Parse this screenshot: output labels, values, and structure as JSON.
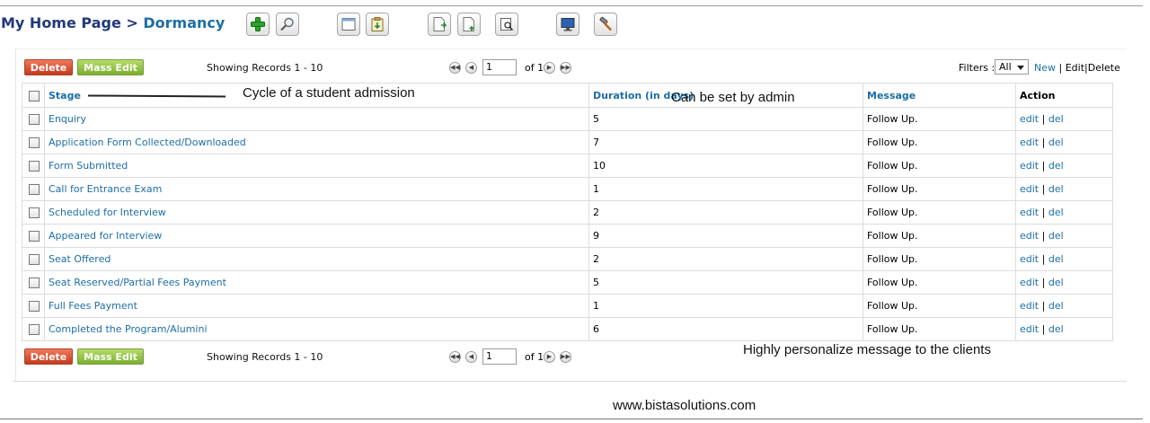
{
  "breadcrumb": {
    "home": "My Home Page",
    "separator": ">",
    "current": "Dormancy"
  },
  "toolbar": {
    "icons": [
      "add-icon",
      "search-icon",
      "window-icon",
      "import-icon",
      "export-icon",
      "export-alt-icon",
      "find-duplicates-icon",
      "monitor-icon",
      "settings-hammer-icon"
    ]
  },
  "actions": {
    "delete_label": "Delete",
    "mass_edit_label": "Mass Edit"
  },
  "pagination": {
    "showing": "Showing Records 1 - 10",
    "page_value": "1",
    "of_pages": "of 1"
  },
  "filters": {
    "label": "Filters :",
    "selected": "All",
    "new": "New",
    "sep": "|",
    "edit": "Edit",
    "delete": "Delete"
  },
  "table": {
    "headers": {
      "stage": "Stage",
      "duration": "Duration (in days)",
      "message": "Message",
      "action": "Action"
    },
    "rows": [
      {
        "stage": "Enquiry",
        "duration": "5",
        "message": "Follow Up."
      },
      {
        "stage": "Application Form Collected/Downloaded",
        "duration": "7",
        "message": "Follow Up."
      },
      {
        "stage": "Form Submitted",
        "duration": "10",
        "message": "Follow Up."
      },
      {
        "stage": "Call for Entrance Exam",
        "duration": "1",
        "message": "Follow Up."
      },
      {
        "stage": "Scheduled for Interview",
        "duration": "2",
        "message": "Follow Up."
      },
      {
        "stage": "Appeared for Interview",
        "duration": "9",
        "message": "Follow Up."
      },
      {
        "stage": "Seat Offered",
        "duration": "2",
        "message": "Follow Up."
      },
      {
        "stage": "Seat Reserved/Partial Fees Payment",
        "duration": "5",
        "message": "Follow Up."
      },
      {
        "stage": "Full Fees Payment",
        "duration": "1",
        "message": "Follow Up."
      },
      {
        "stage": "Completed the Program/Alumini",
        "duration": "6",
        "message": "Follow Up."
      }
    ],
    "edit_label": "edit",
    "del_label": "del",
    "action_sep": "|"
  },
  "annotations": {
    "stage_note": "Cycle of a student admission",
    "duration_note": "Can be set by admin",
    "message_note": "Highly personalize message to the clients",
    "website": "www.bistasolutions.com"
  },
  "colors": {
    "link": "#1c6ea6",
    "breadcrumb_home": "#22377d",
    "delete_button": "#c53a1c",
    "mass_edit_button": "#7aaf2c"
  }
}
